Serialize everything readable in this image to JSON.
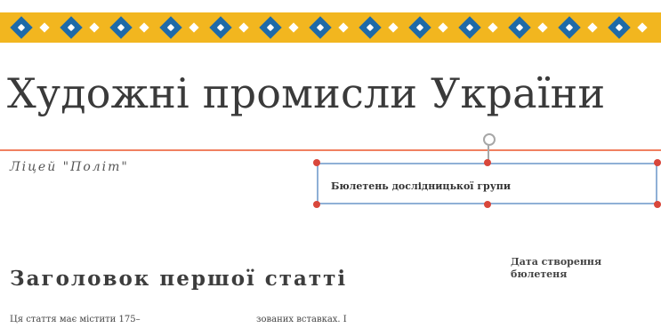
{
  "colors": {
    "band": "#f2b61f",
    "motif": "#1e6aa8",
    "rule": "#f08060",
    "selection": "#8fb0d6",
    "handle": "#d9473b"
  },
  "document": {
    "title": "Художні промисли України",
    "school": "Ліцей \"Політ\"",
    "bulletin_label": "Бюлетень дослідницької групи",
    "article_heading": "Заголовок першої статті",
    "date_label": "Дата створення бюлетеня",
    "body_left": "Ця стаття має містити 175–",
    "body_right": "зованих вставках. І"
  },
  "icons": {
    "rotate_handle": "rotate-handle-icon",
    "resize_handle": "resize-handle-icon"
  }
}
